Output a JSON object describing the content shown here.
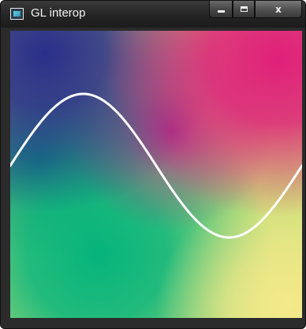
{
  "window": {
    "title": "GL interop",
    "app_icon": "app-window-icon",
    "buttons": {
      "minimize_icon": "minimize-icon",
      "maximize_icon": "maximize-icon",
      "close_label": "x",
      "close_icon": "close-icon"
    }
  },
  "canvas": {
    "gradient_colors": {
      "top_left": "#2a2f8a",
      "top_right": "#e0207a",
      "bottom_left": "#05b47c",
      "bottom_right": "#f4e98a",
      "left_middle": "#0a6b86"
    },
    "curve": {
      "shape": "sine",
      "color": "#ffffff",
      "cycles": 1
    }
  }
}
